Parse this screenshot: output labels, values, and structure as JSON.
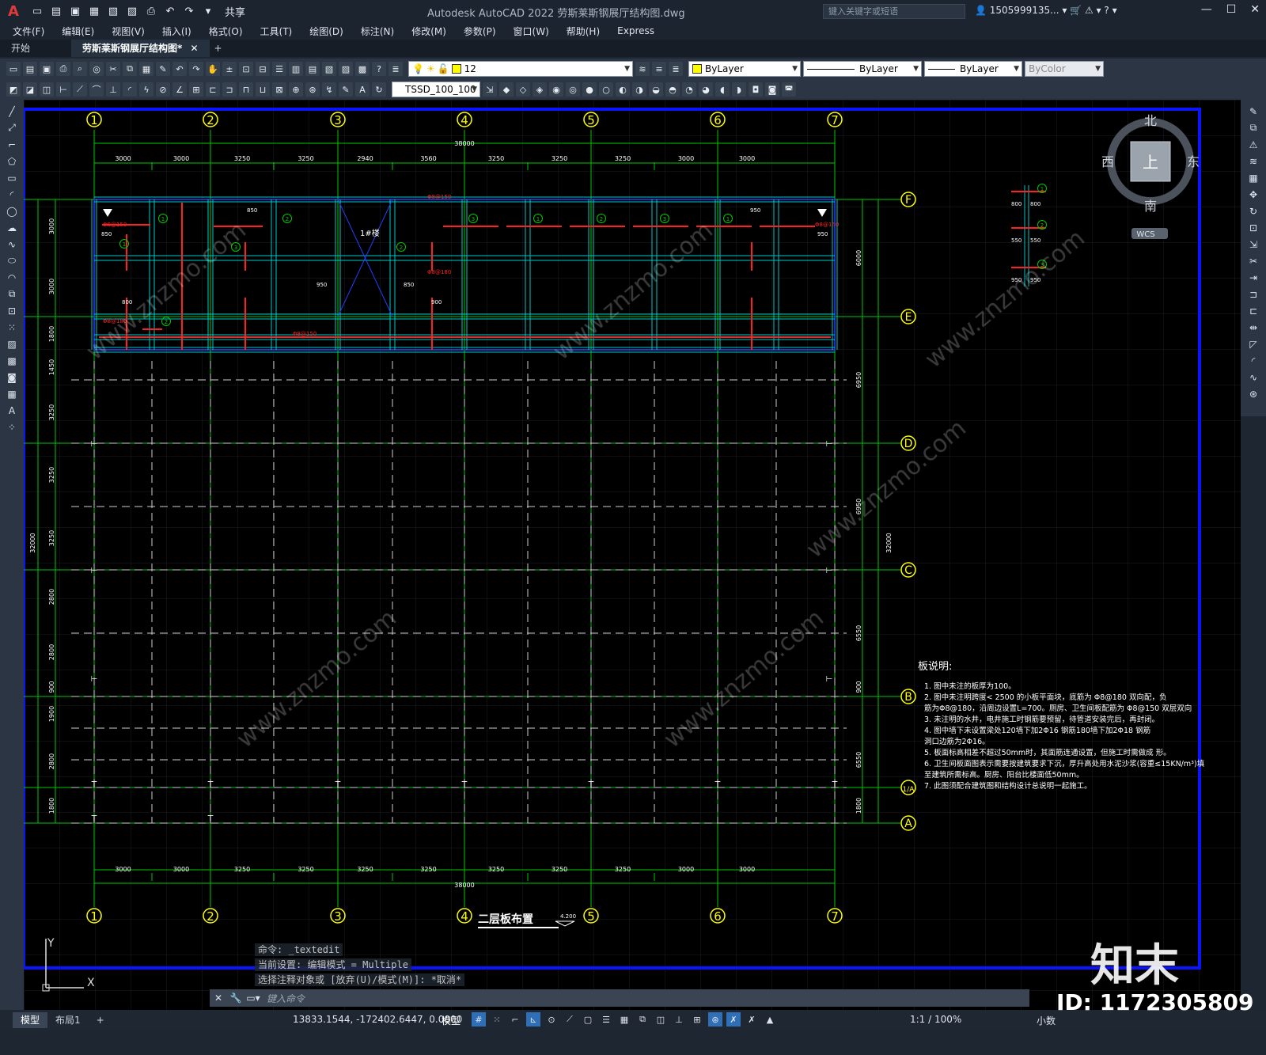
{
  "app": {
    "logo": "A",
    "title": "Autodesk AutoCAD 2022    劳斯莱斯钢展厅结构图.dwg",
    "share": "共享",
    "search_placeholder": "键入关键字或短语",
    "user": "1505999135..."
  },
  "menu": [
    "文件(F)",
    "编辑(E)",
    "视图(V)",
    "插入(I)",
    "格式(O)",
    "工具(T)",
    "绘图(D)",
    "标注(N)",
    "修改(M)",
    "参数(P)",
    "窗口(W)",
    "帮助(H)",
    "Express"
  ],
  "tabs": {
    "start": "开始",
    "active": "劳斯莱斯钢展厅结构图*",
    "close": "✕",
    "add": "+"
  },
  "toolbar": {
    "layer": "12",
    "color": "ByLayer",
    "linetype": "ByLayer",
    "lineweight": "ByLayer",
    "plotstyle": "ByColor",
    "dimstyle": "TSSD_100_100"
  },
  "viewcube": {
    "north": "北",
    "south": "南",
    "east": "东",
    "west": "西",
    "top": "上",
    "wcs": "WCS"
  },
  "drawing": {
    "columns": [
      "1",
      "2",
      "3",
      "4",
      "5",
      "6",
      "7"
    ],
    "rows_right": [
      "F",
      "E",
      "D",
      "C",
      "B",
      "1/A",
      "A"
    ],
    "total_width": "38000",
    "total_height": "32000",
    "top_spans": [
      "3000",
      "3000",
      "3250",
      "3250",
      "2940",
      "3560",
      "3250",
      "3250",
      "3250",
      "3000",
      "3000"
    ],
    "bottom_spans": [
      "3000",
      "3000",
      "3250",
      "3250",
      "3250",
      "3250",
      "3250",
      "3250",
      "3250",
      "3000",
      "3000"
    ],
    "left_dims": [
      "3000",
      "3000",
      "1800",
      "1450",
      "3250",
      "3250",
      "3250",
      "2800",
      "2800",
      "900",
      "1900",
      "2800",
      "1800"
    ],
    "right_dims": [
      "6000",
      "6950",
      "6950",
      "6550",
      "6550",
      "900",
      "1800"
    ],
    "stair_label": "1#楼",
    "title": "二层板布置",
    "elevation": "4.200",
    "rebar_labels": [
      "Φ8@150",
      "Φ8@180",
      "Φ8@150",
      "Φ8@150",
      "Φ8@180",
      "Φ8@150"
    ],
    "small_dims": [
      "850",
      "950",
      "850",
      "950",
      "850",
      "950",
      "800",
      "900"
    ],
    "detail_dims": [
      "800",
      "800",
      "550",
      "550",
      "950",
      "950"
    ],
    "notes_title": "板说明:",
    "notes": [
      "1. 图中未注的板厚为100。",
      "2. 图中未注明跨度< 2500 的小板平面块，底筋为 Φ8@180 双向配，负",
      "   筋为Φ8@180，沿周边设置L=700。厕房、卫生间板配筋为 Φ8@150 双层双向",
      "3. 未注明的水井，电井施工时钢筋要预留，待管道安装完后，再封闭。",
      "4. 图中墙下未设置梁处120墙下加2Φ16 钢筋180墙下加2Φ18 钢筋",
      "   洞口边筋为2Φ16。",
      "5. 板面标高相差不超过50mm时，其面筋连通设置，但施工时需做成        形。",
      "6. 卫生间板面图表示需要按建筑要求下沉，厚升高处用水泥沙浆(容重≤15KN/m³)填",
      "   至建筑所需标高。厨房、阳台比楼面低50mm。",
      "7. 此图须配合建筑图和结构设计总说明一起施工。"
    ]
  },
  "command": {
    "history": [
      "命令: _textedit",
      "当前设置: 编辑模式 = Multiple",
      "选择注释对象或 [放弃(U)/模式(M)]: *取消*"
    ],
    "placeholder": "键入命令"
  },
  "status": {
    "model_tab": "模型",
    "layout_tab": "布局1",
    "coords": "13833.1544, -172402.6447, 0.0000",
    "model": "模型",
    "scale": "1:1 / 100%",
    "units": "小数"
  },
  "watermark": {
    "logo": "知末",
    "id": "ID: 1172305809",
    "site": "www.znzmo.com"
  },
  "colors": {
    "grid_axis": "#00c800",
    "beam": "#00c8c8",
    "rebar": "#ff2020",
    "boundary": "#0000ff",
    "bubble": "#ffff00"
  }
}
